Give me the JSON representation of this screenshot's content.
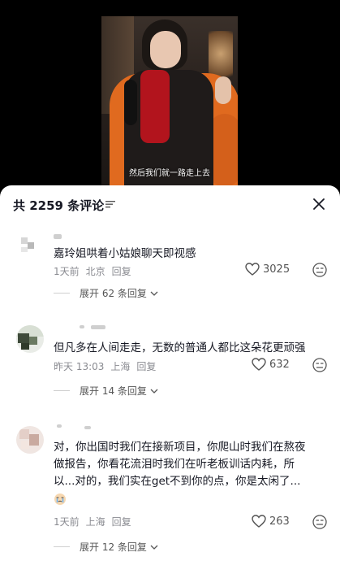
{
  "video": {
    "subtitle": "然后我们就一路走上去"
  },
  "comments_panel": {
    "title": "共 2259 条评论",
    "sort_icon": "sort-lines-icon",
    "close_icon": "close-icon"
  },
  "comments": [
    {
      "text": "嘉玲姐哄着小姑娘聊天即视感",
      "time": "1天前",
      "location": "北京",
      "reply_label": "回复",
      "likes": "3025",
      "expand_label": "展开 62 条回复"
    },
    {
      "text": "但凡多在人间走走，无数的普通人都比这朵花更顽强",
      "time": "昨天 13:03",
      "location": "上海",
      "reply_label": "回复",
      "likes": "632",
      "expand_label": "展开 14 条回复"
    },
    {
      "text_lines": [
        "对，你出国时我们在接新项目，你爬山时我们在熬夜",
        "做报告，你看花流泪时我们在听老板训话内耗，所",
        "以...对的，我们实在get不到你的点，你是太闲了..."
      ],
      "emoji": "crying-face-emoji",
      "time": "1天前",
      "location": "上海",
      "reply_label": "回复",
      "likes": "263",
      "expand_label": "展开 12 条回复"
    }
  ],
  "colors": {
    "accent_text": "#161823",
    "meta_text": "#8a8b91",
    "scarf_red": "#b2141d",
    "chair_orange": "#e06a1f"
  }
}
